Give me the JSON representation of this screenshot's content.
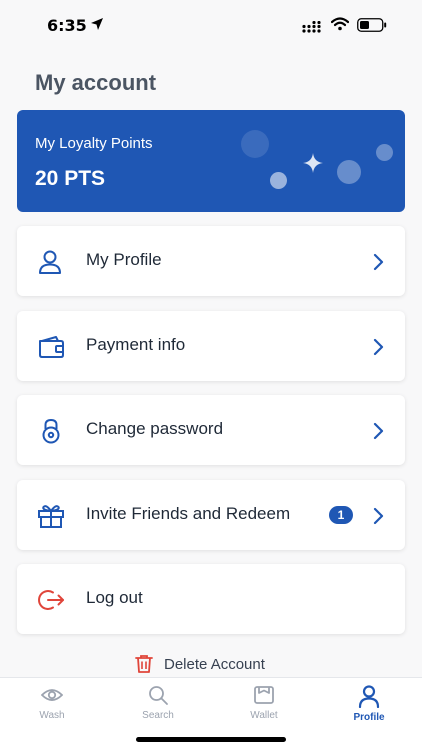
{
  "status_bar": {
    "time": "6:35"
  },
  "header": {
    "title": "My account"
  },
  "loyalty": {
    "label": "My Loyalty Points",
    "points": "20 PTS"
  },
  "menu": {
    "items": [
      {
        "label": "My Profile",
        "icon": "user-icon"
      },
      {
        "label": "Payment info",
        "icon": "wallet-icon"
      },
      {
        "label": "Change password",
        "icon": "lock-icon"
      },
      {
        "label": "Invite Friends and Redeem",
        "icon": "gift-icon",
        "badge": "1"
      },
      {
        "label": "Log out",
        "icon": "logout-icon"
      }
    ]
  },
  "delete_account": {
    "label": "Delete Account",
    "icon": "trash-icon"
  },
  "tab_bar": {
    "tabs": [
      {
        "label": "Wash",
        "icon": "eye-icon"
      },
      {
        "label": "Search",
        "icon": "search-icon"
      },
      {
        "label": "Wallet",
        "icon": "wallet-tab-icon"
      },
      {
        "label": "Profile",
        "icon": "profile-icon",
        "active": true
      }
    ]
  },
  "colors": {
    "primary": "#1f57b4",
    "danger": "#e0453a",
    "background": "#f8f8f9",
    "inactive": "#9ca3af"
  }
}
